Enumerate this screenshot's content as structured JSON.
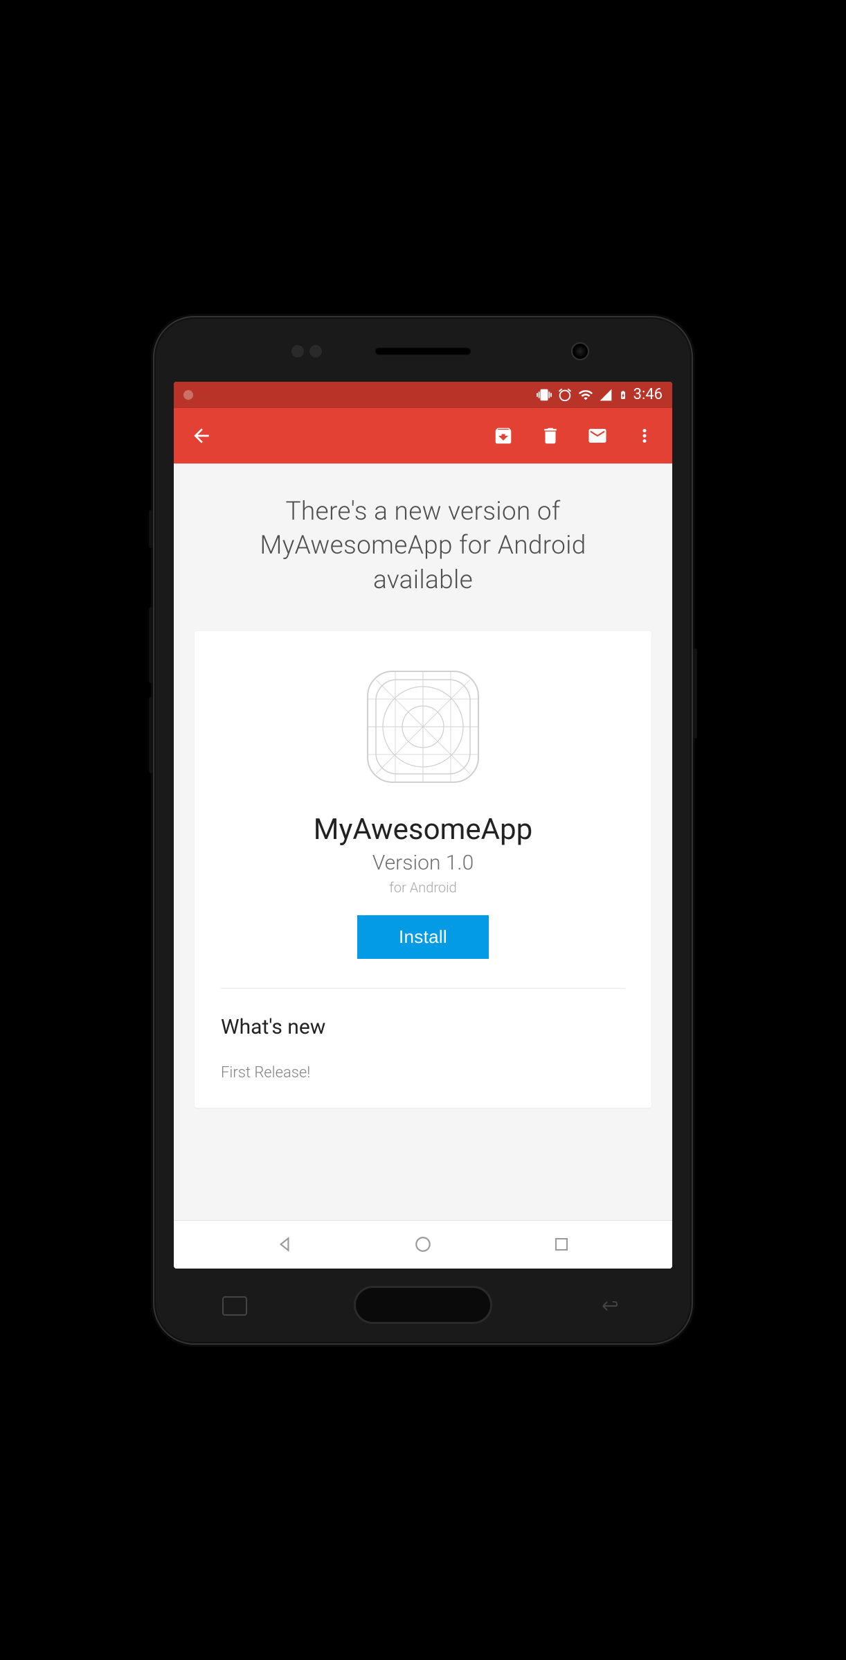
{
  "statusBar": {
    "time": "3:46"
  },
  "hero": {
    "title": "There's a new version of MyAwesomeApp for Android available"
  },
  "app": {
    "name": "MyAwesomeApp",
    "version": "Version 1.0",
    "platform": "for Android",
    "installLabel": "Install"
  },
  "whatsNew": {
    "title": "What's new",
    "body": "First Release!"
  },
  "colors": {
    "toolbar": "#e34133",
    "statusBar": "#b83328",
    "primaryButton": "#039be5"
  }
}
